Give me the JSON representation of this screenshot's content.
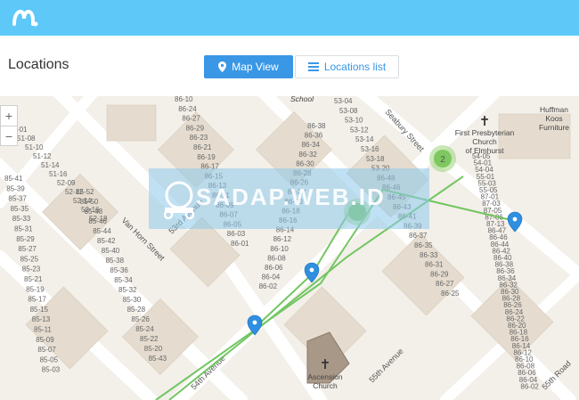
{
  "app": {
    "logo_icon": "mspy-logo-icon"
  },
  "page": {
    "title": "Locations"
  },
  "toggle": {
    "map_view_label": "Map View",
    "locations_list_label": "Locations list"
  },
  "zoom": {
    "in_label": "+",
    "out_label": "−"
  },
  "watermark": {
    "text": "SADAP.WEB.ID"
  },
  "map": {
    "streets": [
      "Van Horn Street",
      "53rd Avenue",
      "54th Avenue",
      "55th Avenue",
      "Seabury Street",
      "55th Road"
    ],
    "landmarks": [
      "First Presbyterian Church of Elmhurst",
      "Ascension Church",
      "Huffman Koos Furniture",
      "School"
    ],
    "cluster_count": "2",
    "colors": {
      "route": "#6cc45a",
      "pin": "#2f8fe0",
      "cluster": "#8fd36e",
      "map_bg": "#f3efe9",
      "building": "#e3d9cc"
    },
    "parcels": [
      "86-10",
      "86-24",
      "86-27",
      "86-29",
      "86-23",
      "86-21",
      "86-19",
      "86-17",
      "86-15",
      "86-13",
      "86-11",
      "86-09",
      "86-07",
      "86-05",
      "86-03",
      "86-01",
      "86-38",
      "86-36",
      "86-34",
      "86-32",
      "86-30",
      "86-28",
      "86-26",
      "53-04",
      "53-08",
      "53-10",
      "53-12",
      "53-14",
      "53-16",
      "53-18",
      "53-20",
      "86-22",
      "86-20",
      "86-18",
      "86-14",
      "86-12",
      "86-06",
      "86-04",
      "86-02",
      "86-37",
      "86-35",
      "86-33",
      "86-31",
      "86-25",
      "86-21",
      "86-17",
      "86-15",
      "86-13",
      "86-11",
      "86-09",
      "86-07",
      "86-05",
      "86-01",
      "86-48",
      "86-46",
      "86-45",
      "86-43",
      "86-41",
      "86-40",
      "86-38",
      "86-36",
      "86-34",
      "86-32",
      "86-30",
      "86-26",
      "86-20",
      "86-18",
      "86-16",
      "86-14",
      "86-12",
      "86-10",
      "86-08",
      "86-06",
      "86-04",
      "86-01",
      "85-44",
      "85-42",
      "85-40",
      "85-38",
      "85-36",
      "85-34",
      "85-32",
      "85-30",
      "85-28",
      "85-26",
      "85-24",
      "85-22",
      "85-20",
      "85-52",
      "85-50",
      "85-48",
      "85-46",
      "85-43",
      "85-41",
      "85-39",
      "85-37",
      "85-35",
      "85-33",
      "85-31",
      "85-29",
      "85-27",
      "85-25",
      "85-23",
      "85-21",
      "85-19",
      "85-17",
      "85-15",
      "85-13",
      "85-11",
      "85-09",
      "85-07",
      "85-05",
      "85-03",
      "85-01",
      "51-01",
      "51-08",
      "51-10",
      "51-12",
      "51-14",
      "51-16",
      "52-09",
      "52-12",
      "52-14",
      "52-16",
      "52-18",
      "54-05",
      "54-01",
      "54-04",
      "55-01",
      "55-03",
      "55-05",
      "87-01",
      "87-03",
      "87-05",
      "87-06",
      "87-13",
      "86-47",
      "86-49",
      "86-44",
      "86-42",
      "86-39"
    ],
    "parcel_labels_top": [
      "86-10",
      "86-24",
      "86-27",
      "86-29",
      "86-23",
      "86-21",
      "86-19",
      "86-17",
      "86-15",
      "86-13",
      "86-11",
      "86-09",
      "86-07",
      "86-05",
      "86-03",
      "86-01"
    ],
    "parcel_labels_mid": [
      "86-38",
      "86-36",
      "86-34",
      "86-32",
      "86-30",
      "86-28",
      "86-26",
      "86-22",
      "86-20",
      "86-18",
      "86-16",
      "86-14",
      "86-12",
      "86-10",
      "86-08",
      "86-06",
      "86-04",
      "86-02"
    ],
    "parcel_labels_right": [
      "53-04",
      "53-08",
      "53-10",
      "53-12",
      "53-14",
      "53-16",
      "53-18",
      "53-20",
      "86-48",
      "86-46",
      "86-45",
      "86-43",
      "86-41",
      "86-39",
      "86-37",
      "86-35",
      "86-33",
      "86-31",
      "86-29",
      "86-27",
      "86-25"
    ],
    "parcel_labels_left": [
      "51-01",
      "51-08",
      "51-10",
      "51-12",
      "51-14",
      "51-16",
      "52-09",
      "52-12",
      "52-14",
      "52-16",
      "52-18",
      "85-52",
      "85-50",
      "85-48",
      "85-46",
      "85-44",
      "85-42",
      "85-40",
      "85-38",
      "85-36",
      "85-34",
      "85-32",
      "85-30",
      "85-28",
      "85-26",
      "85-24",
      "85-22",
      "85-20",
      "85-43",
      "85-41",
      "85-39",
      "85-37",
      "85-35",
      "85-33",
      "85-31",
      "85-29",
      "85-27",
      "85-25",
      "85-23",
      "85-21",
      "85-19",
      "85-17",
      "85-15",
      "85-13",
      "85-11",
      "85-09",
      "85-07",
      "85-05",
      "85-03"
    ],
    "parcel_labels_se": [
      "54-05",
      "54-01",
      "54-04",
      "55-01",
      "55-03",
      "55-05",
      "87-01",
      "87-03",
      "87-05",
      "87-06",
      "87-13",
      "86-47",
      "86-46",
      "86-44",
      "86-42",
      "86-40",
      "86-38",
      "86-36",
      "86-34",
      "86-32",
      "86-30",
      "86-28",
      "86-26",
      "86-24",
      "86-22",
      "86-20",
      "86-18",
      "86-16",
      "86-14",
      "86-12",
      "86-10",
      "86-08",
      "86-06",
      "86-04",
      "86-02"
    ]
  }
}
